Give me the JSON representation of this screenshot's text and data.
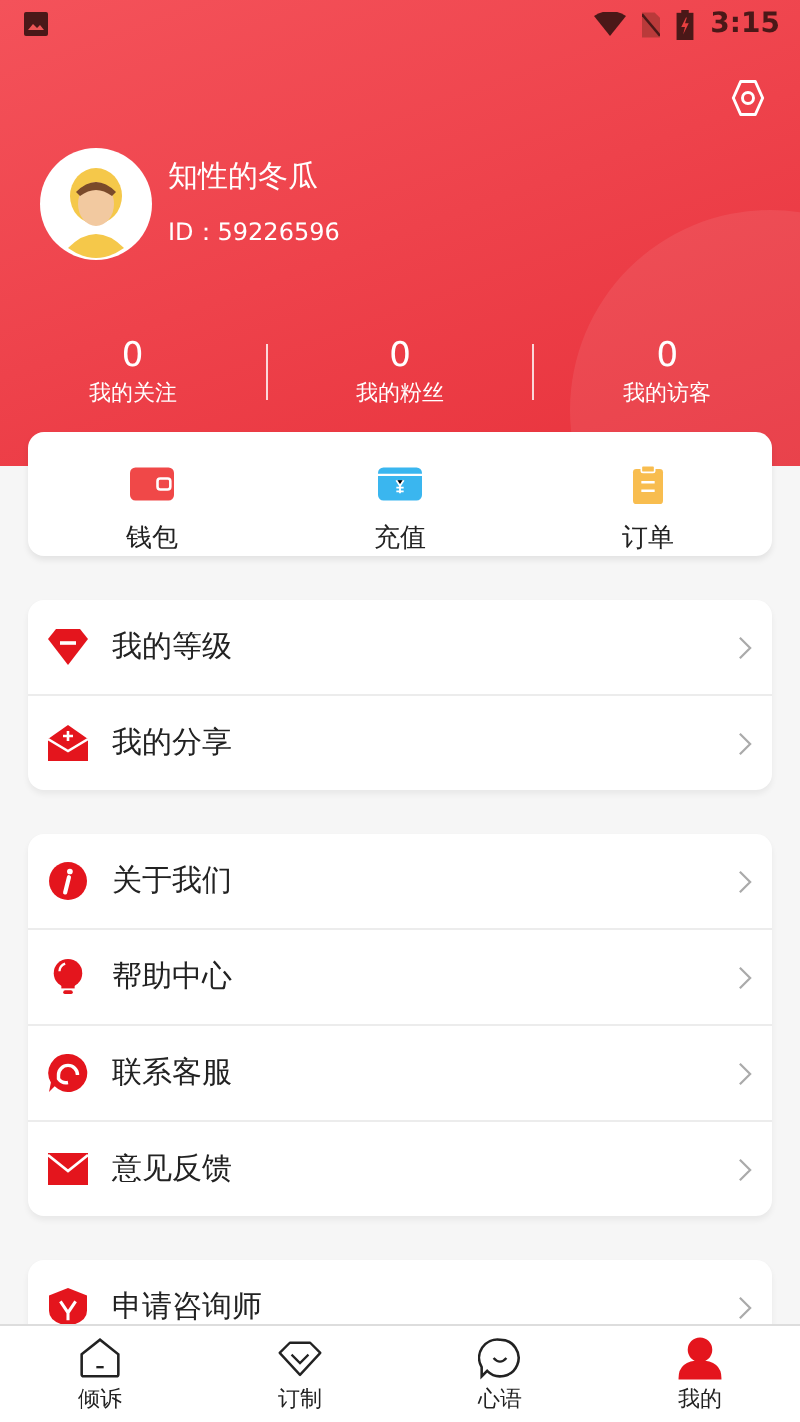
{
  "status_bar": {
    "time": "3:15"
  },
  "profile": {
    "name": "知性的冬瓜",
    "id": "ID：59226596"
  },
  "stats": [
    {
      "value": "0",
      "label": "我的关注"
    },
    {
      "value": "0",
      "label": "我的粉丝"
    },
    {
      "value": "0",
      "label": "我的访客"
    }
  ],
  "quick_actions": [
    {
      "kind": "wallet",
      "label": "钱包"
    },
    {
      "kind": "recharge",
      "label": "充值"
    },
    {
      "kind": "orders",
      "label": "订单"
    }
  ],
  "menu_groups": [
    [
      {
        "kind": "level",
        "label": "我的等级"
      },
      {
        "kind": "share",
        "label": "我的分享"
      }
    ],
    [
      {
        "kind": "about",
        "label": "关于我们"
      },
      {
        "kind": "help",
        "label": "帮助中心"
      },
      {
        "kind": "service",
        "label": "联系客服"
      },
      {
        "kind": "feedback",
        "label": "意见反馈"
      }
    ],
    [
      {
        "kind": "apply",
        "label": "申请咨询师"
      }
    ]
  ],
  "tab_bar": [
    {
      "kind": "home",
      "label": "倾诉",
      "selected": false
    },
    {
      "kind": "custom",
      "label": "订制",
      "selected": false
    },
    {
      "kind": "chat",
      "label": "心语",
      "selected": false
    },
    {
      "kind": "me",
      "label": "我的",
      "selected": true
    }
  ]
}
